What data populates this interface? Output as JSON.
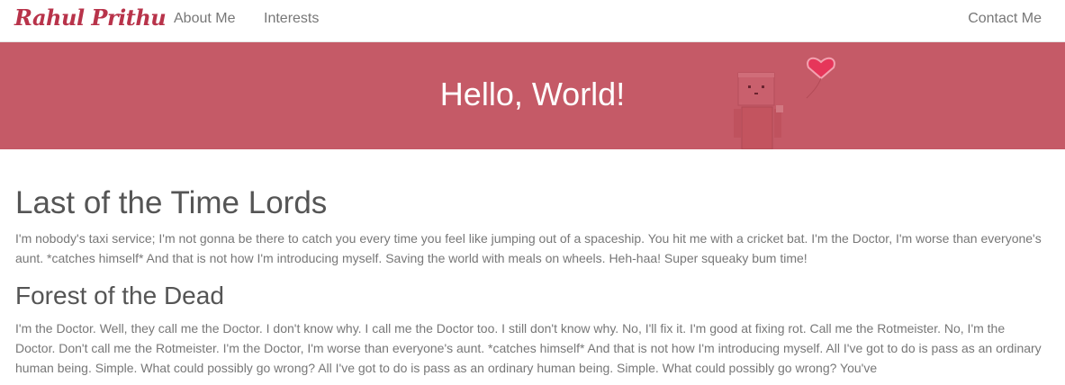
{
  "navbar": {
    "brand": "Rahul Prithu",
    "links": [
      "About Me",
      "Interests"
    ],
    "contact": "Contact Me"
  },
  "hero": {
    "title": "Hello, World!"
  },
  "sections": [
    {
      "title": "Last of the Time Lords",
      "body": "I'm nobody's taxi service; I'm not gonna be there to catch you every time you feel like jumping out of a spaceship. You hit me with a cricket bat. I'm the Doctor, I'm worse than everyone's aunt. *catches himself* And that is not how I'm introducing myself. Saving the world with meals on wheels. Heh-haa! Super squeaky bum time!"
    },
    {
      "title": "Forest of the Dead",
      "body": "I'm the Doctor. Well, they call me the Doctor. I don't know why. I call me the Doctor too. I still don't know why. No, I'll fix it. I'm good at fixing rot. Call me the Rotmeister. No, I'm the Doctor. Don't call me the Rotmeister. I'm the Doctor, I'm worse than everyone's aunt. *catches himself* And that is not how I'm introducing myself. All I've got to do is pass as an ordinary human being. Simple. What could possibly go wrong? All I've got to do is pass as an ordinary human being. Simple. What could possibly go wrong? You've"
    }
  ],
  "colors": {
    "brand": "#b8334a",
    "hero_background": "#c55a67",
    "text": "#777777",
    "heading": "#555555"
  }
}
